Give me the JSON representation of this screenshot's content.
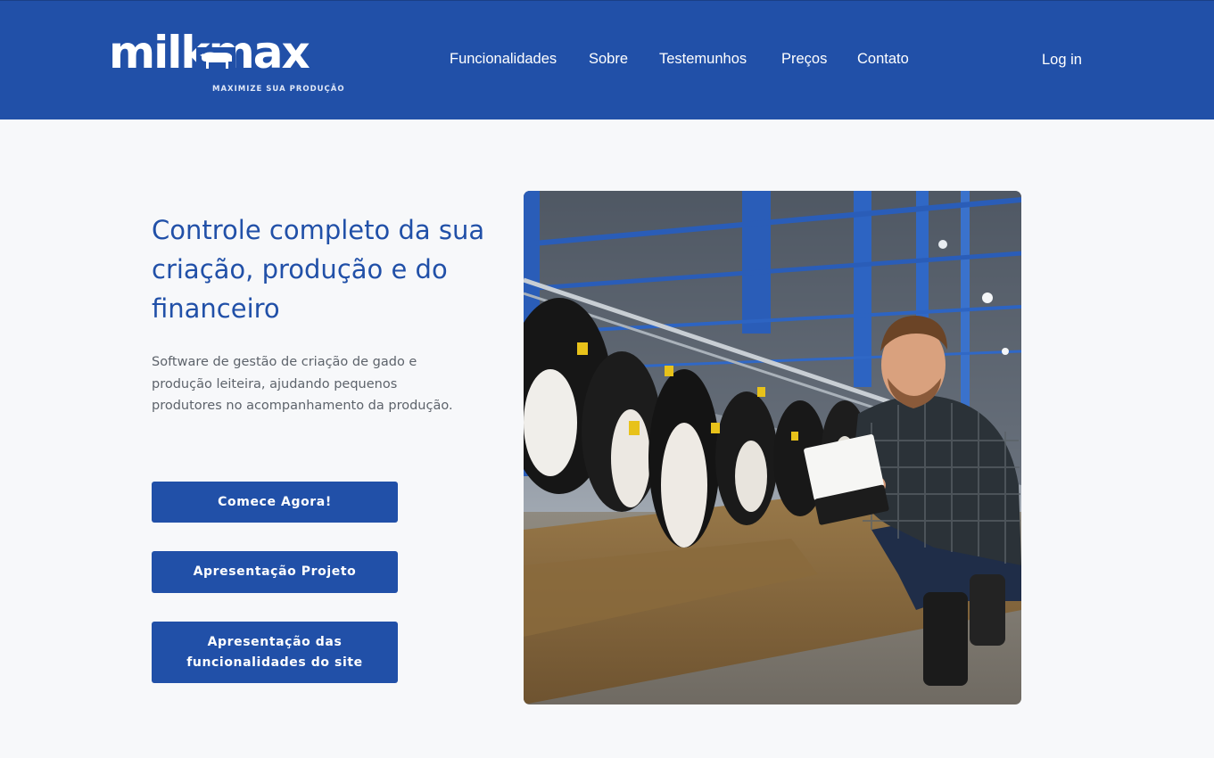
{
  "brand": {
    "name": "milkmax",
    "tagline": "MAXIMIZE SUA PRODUÇÃO"
  },
  "nav": {
    "items": [
      "Funcionalidades",
      "Sobre",
      "Testemunhos",
      "Preços",
      "Contato"
    ],
    "login_label": "Log in"
  },
  "hero": {
    "title": "Controle completo da sua criação, produção e do financeiro",
    "description": "Software de gestão de criação de gado e produção leiteira, ajudando pequenos produtores no acompanhamento da produção.",
    "buttons": {
      "start": "Comece Agora!",
      "project": "Apresentação Projeto",
      "features": "Apresentação das funcionalidades do site"
    }
  },
  "colors": {
    "brand_blue": "#2150a8",
    "background": "#f7f8fa",
    "text_muted": "#5d636b"
  },
  "images": {
    "hero_photo": "farmer-with-clipboard-in-dairy-barn"
  }
}
